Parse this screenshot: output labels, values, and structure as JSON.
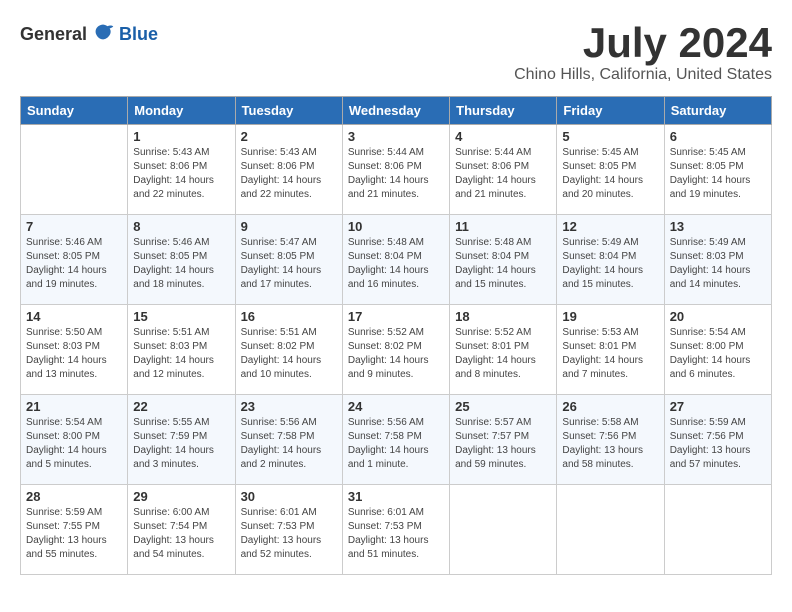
{
  "logo": {
    "general": "General",
    "blue": "Blue"
  },
  "title": "July 2024",
  "subtitle": "Chino Hills, California, United States",
  "headers": [
    "Sunday",
    "Monday",
    "Tuesday",
    "Wednesday",
    "Thursday",
    "Friday",
    "Saturday"
  ],
  "weeks": [
    [
      {
        "day": "",
        "info": ""
      },
      {
        "day": "1",
        "info": "Sunrise: 5:43 AM\nSunset: 8:06 PM\nDaylight: 14 hours\nand 22 minutes."
      },
      {
        "day": "2",
        "info": "Sunrise: 5:43 AM\nSunset: 8:06 PM\nDaylight: 14 hours\nand 22 minutes."
      },
      {
        "day": "3",
        "info": "Sunrise: 5:44 AM\nSunset: 8:06 PM\nDaylight: 14 hours\nand 21 minutes."
      },
      {
        "day": "4",
        "info": "Sunrise: 5:44 AM\nSunset: 8:06 PM\nDaylight: 14 hours\nand 21 minutes."
      },
      {
        "day": "5",
        "info": "Sunrise: 5:45 AM\nSunset: 8:05 PM\nDaylight: 14 hours\nand 20 minutes."
      },
      {
        "day": "6",
        "info": "Sunrise: 5:45 AM\nSunset: 8:05 PM\nDaylight: 14 hours\nand 19 minutes."
      }
    ],
    [
      {
        "day": "7",
        "info": "Sunrise: 5:46 AM\nSunset: 8:05 PM\nDaylight: 14 hours\nand 19 minutes."
      },
      {
        "day": "8",
        "info": "Sunrise: 5:46 AM\nSunset: 8:05 PM\nDaylight: 14 hours\nand 18 minutes."
      },
      {
        "day": "9",
        "info": "Sunrise: 5:47 AM\nSunset: 8:05 PM\nDaylight: 14 hours\nand 17 minutes."
      },
      {
        "day": "10",
        "info": "Sunrise: 5:48 AM\nSunset: 8:04 PM\nDaylight: 14 hours\nand 16 minutes."
      },
      {
        "day": "11",
        "info": "Sunrise: 5:48 AM\nSunset: 8:04 PM\nDaylight: 14 hours\nand 15 minutes."
      },
      {
        "day": "12",
        "info": "Sunrise: 5:49 AM\nSunset: 8:04 PM\nDaylight: 14 hours\nand 15 minutes."
      },
      {
        "day": "13",
        "info": "Sunrise: 5:49 AM\nSunset: 8:03 PM\nDaylight: 14 hours\nand 14 minutes."
      }
    ],
    [
      {
        "day": "14",
        "info": "Sunrise: 5:50 AM\nSunset: 8:03 PM\nDaylight: 14 hours\nand 13 minutes."
      },
      {
        "day": "15",
        "info": "Sunrise: 5:51 AM\nSunset: 8:03 PM\nDaylight: 14 hours\nand 12 minutes."
      },
      {
        "day": "16",
        "info": "Sunrise: 5:51 AM\nSunset: 8:02 PM\nDaylight: 14 hours\nand 10 minutes."
      },
      {
        "day": "17",
        "info": "Sunrise: 5:52 AM\nSunset: 8:02 PM\nDaylight: 14 hours\nand 9 minutes."
      },
      {
        "day": "18",
        "info": "Sunrise: 5:52 AM\nSunset: 8:01 PM\nDaylight: 14 hours\nand 8 minutes."
      },
      {
        "day": "19",
        "info": "Sunrise: 5:53 AM\nSunset: 8:01 PM\nDaylight: 14 hours\nand 7 minutes."
      },
      {
        "day": "20",
        "info": "Sunrise: 5:54 AM\nSunset: 8:00 PM\nDaylight: 14 hours\nand 6 minutes."
      }
    ],
    [
      {
        "day": "21",
        "info": "Sunrise: 5:54 AM\nSunset: 8:00 PM\nDaylight: 14 hours\nand 5 minutes."
      },
      {
        "day": "22",
        "info": "Sunrise: 5:55 AM\nSunset: 7:59 PM\nDaylight: 14 hours\nand 3 minutes."
      },
      {
        "day": "23",
        "info": "Sunrise: 5:56 AM\nSunset: 7:58 PM\nDaylight: 14 hours\nand 2 minutes."
      },
      {
        "day": "24",
        "info": "Sunrise: 5:56 AM\nSunset: 7:58 PM\nDaylight: 14 hours\nand 1 minute."
      },
      {
        "day": "25",
        "info": "Sunrise: 5:57 AM\nSunset: 7:57 PM\nDaylight: 13 hours\nand 59 minutes."
      },
      {
        "day": "26",
        "info": "Sunrise: 5:58 AM\nSunset: 7:56 PM\nDaylight: 13 hours\nand 58 minutes."
      },
      {
        "day": "27",
        "info": "Sunrise: 5:59 AM\nSunset: 7:56 PM\nDaylight: 13 hours\nand 57 minutes."
      }
    ],
    [
      {
        "day": "28",
        "info": "Sunrise: 5:59 AM\nSunset: 7:55 PM\nDaylight: 13 hours\nand 55 minutes."
      },
      {
        "day": "29",
        "info": "Sunrise: 6:00 AM\nSunset: 7:54 PM\nDaylight: 13 hours\nand 54 minutes."
      },
      {
        "day": "30",
        "info": "Sunrise: 6:01 AM\nSunset: 7:53 PM\nDaylight: 13 hours\nand 52 minutes."
      },
      {
        "day": "31",
        "info": "Sunrise: 6:01 AM\nSunset: 7:53 PM\nDaylight: 13 hours\nand 51 minutes."
      },
      {
        "day": "",
        "info": ""
      },
      {
        "day": "",
        "info": ""
      },
      {
        "day": "",
        "info": ""
      }
    ]
  ]
}
